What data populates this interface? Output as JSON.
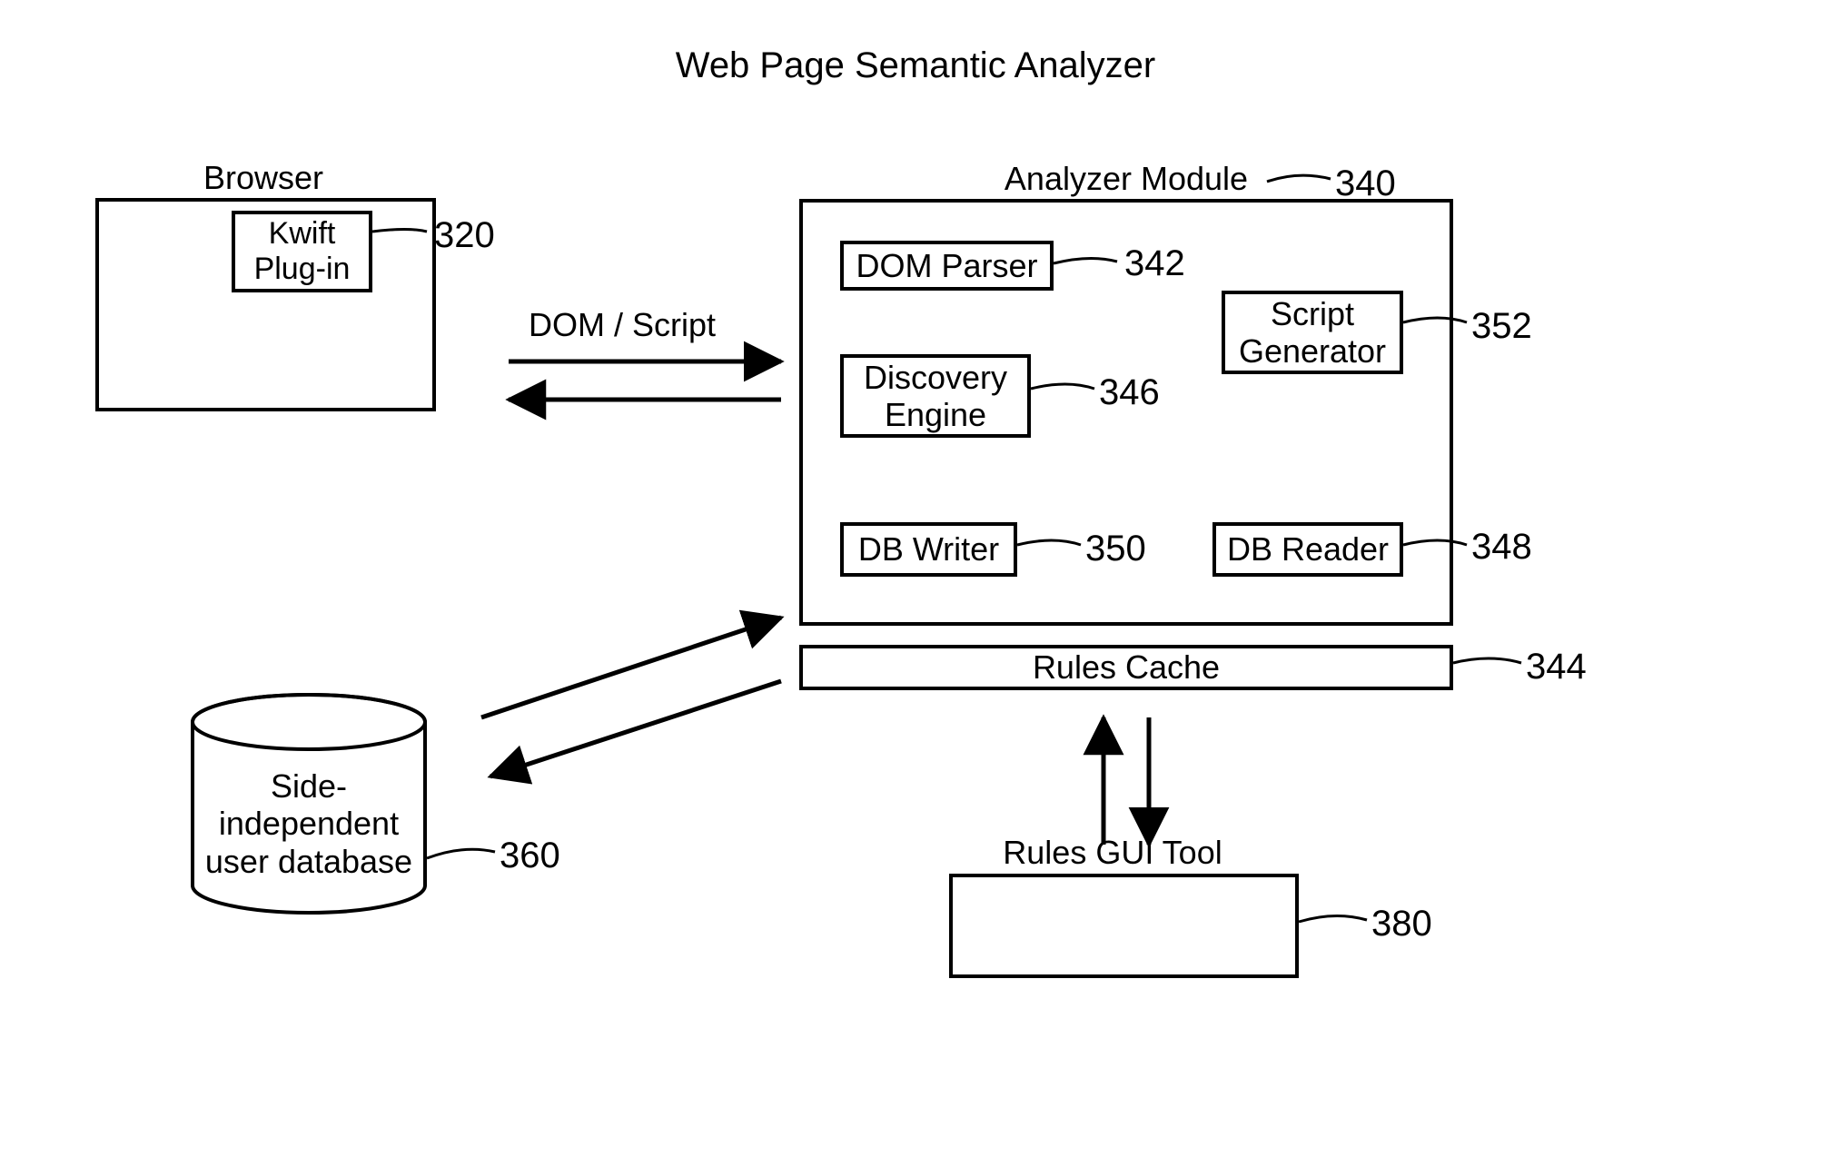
{
  "title": "Web Page Semantic Analyzer",
  "browser": {
    "label": "Browser"
  },
  "plugin": {
    "label": "Kwift\nPlug-in",
    "ref": "320"
  },
  "domscript": {
    "label": "DOM / Script"
  },
  "analyzer": {
    "label": "Analyzer Module",
    "ref": "340"
  },
  "domparser": {
    "label": "DOM Parser",
    "ref": "342"
  },
  "discovery": {
    "label": "Discovery\nEngine",
    "ref": "346"
  },
  "dbwriter": {
    "label": "DB Writer",
    "ref": "350"
  },
  "scriptgen": {
    "label": "Script\nGenerator",
    "ref": "352"
  },
  "dbreader": {
    "label": "DB Reader",
    "ref": "348"
  },
  "rulescache": {
    "label": "Rules Cache",
    "ref": "344"
  },
  "db": {
    "label": "Side-\nindependent\nuser database",
    "ref": "360"
  },
  "rulestool": {
    "label": "Rules GUI Tool",
    "ref": "380"
  }
}
